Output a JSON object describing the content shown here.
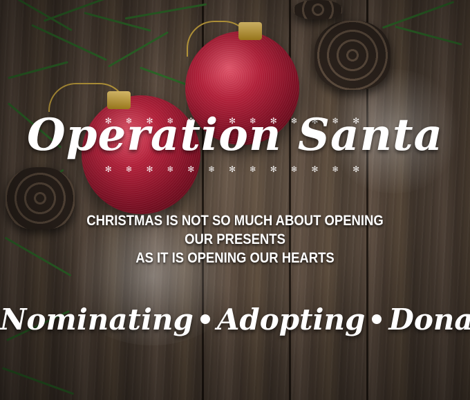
{
  "title": "Operation Santa",
  "sparkle_glyphs": "✻ ❄ ✻ ❄ ✻ ❄ ✻ ❄ ✻ ❄ ✻ ❄ ✻",
  "quote": {
    "line1": "CHRISTMAS IS NOT SO MUCH ABOUT OPENING",
    "line2": "OUR PRESENTS",
    "line3": "AS IT IS OPENING OUR HEARTS"
  },
  "tagline": [
    "Nominating",
    "Adopting",
    "Donating"
  ],
  "colors": {
    "ornament": "#9b1a30",
    "cap": "#d4b04a",
    "text": "#ffffff",
    "wood": "#4e4136",
    "pine": "#2f6b2a"
  }
}
